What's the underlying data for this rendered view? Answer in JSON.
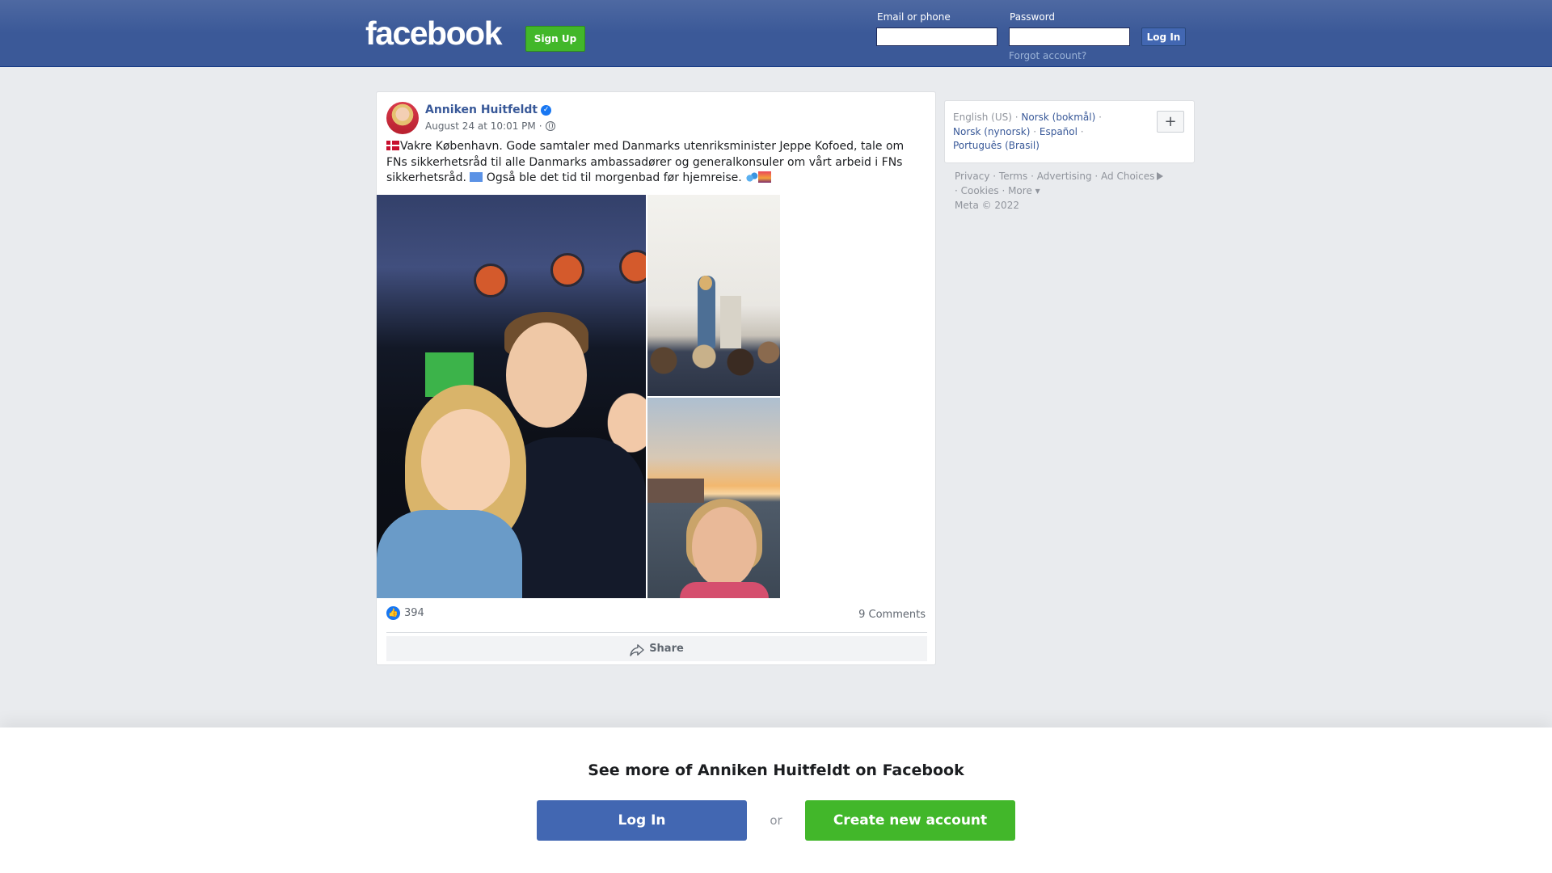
{
  "header": {
    "logo": "facebook",
    "signup_label": "Sign Up",
    "email_label": "Email or phone",
    "password_label": "Password",
    "login_label": "Log In",
    "forgot_label": "Forgot account?"
  },
  "post": {
    "author": "Anniken Huitfeldt",
    "timestamp": "August 24 at 10:01 PM",
    "privacy_separator": "·",
    "text_part1": "Vakre København. Gode samtaler med Danmarks utenriksminister Jeppe Kofoed, tale om FNs sikkerhetsråd til alle Danmarks ambassadører og generalkonsuler om vårt arbeid i FNs sikkerhetsråd. ",
    "text_part2": " Også ble det tid til morgenbad før hjemreise. ",
    "reaction_count": "394",
    "comments_label": "9 Comments",
    "share_label": "Share"
  },
  "sidebar": {
    "languages": [
      {
        "label": "English (US)",
        "active": true
      },
      {
        "label": "Norsk (bokmål)",
        "active": false
      },
      {
        "label": "Norsk (nynorsk)",
        "active": false
      },
      {
        "label": "Español",
        "active": false
      },
      {
        "label": "Português (Brasil)",
        "active": false
      }
    ],
    "footer_links": [
      "Privacy",
      "Terms",
      "Advertising",
      "Ad Choices",
      "Cookies",
      "More"
    ],
    "copyright": "Meta © 2022"
  },
  "bottom": {
    "title": "See more of Anniken Huitfeldt on Facebook",
    "login_label": "Log In",
    "or_label": "or",
    "create_label": "Create new account"
  },
  "colors": {
    "header_blue": "#3b5998",
    "link_blue": "#385898",
    "login_button_blue": "#4267b2",
    "signup_green": "#42b72a",
    "page_background": "#e9ebee"
  },
  "icons": [
    "verified-badge-icon",
    "globe-icon",
    "like-icon",
    "share-icon",
    "plus-icon",
    "ad-choices-icon"
  ]
}
